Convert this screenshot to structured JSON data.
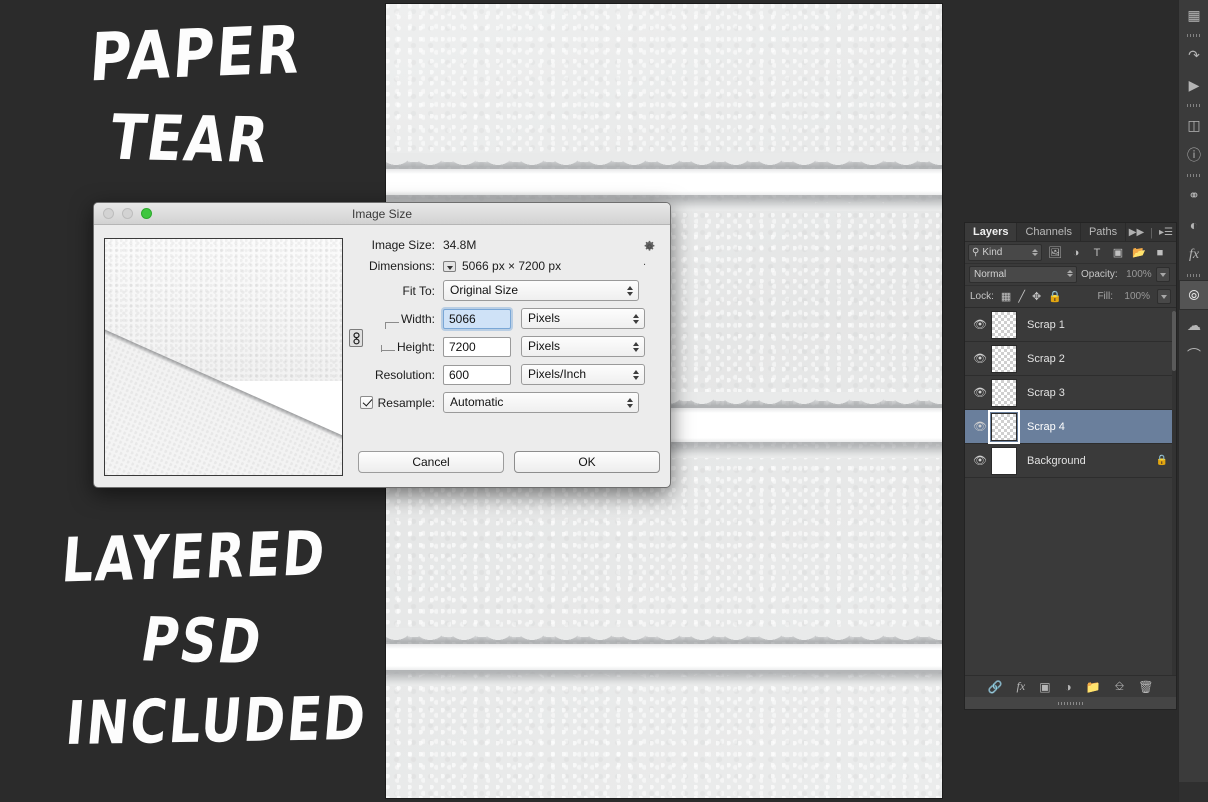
{
  "promo": {
    "line1": "PAPER",
    "line2": "TEAR",
    "line3": "LAYERED",
    "line4": "PSD",
    "line5": "INCLUDED"
  },
  "colors": {
    "app_background": "#2b2b2b",
    "panel_background": "#3a3a3a",
    "selection_blue": "#6a7f9c",
    "dialog_background": "#ececec",
    "focus_field_blue": "#cfe2f7",
    "traffic_light_green": "#3fc63f",
    "paper_gray": "#e9eaea",
    "tear_white": "#ffffff"
  },
  "dialog": {
    "title": "Image Size",
    "traffic_lights": [
      "close-disabled",
      "minimize-disabled",
      "zoom-green"
    ],
    "gear_icon": "gear-icon",
    "rows": {
      "image_size_label": "Image Size:",
      "image_size_value": "34.8M",
      "dimensions_label": "Dimensions:",
      "dimensions_value": "5066 px  ×  7200 px",
      "fit_to_label": "Fit To:",
      "fit_to_value": "Original Size",
      "width_label": "Width:",
      "width_value": "5066",
      "width_unit": "Pixels",
      "height_label": "Height:",
      "height_value": "7200",
      "height_unit": "Pixels",
      "resolution_label": "Resolution:",
      "resolution_value": "600",
      "resolution_unit": "Pixels/Inch",
      "resample_label": "Resample:",
      "resample_value": "Automatic",
      "resample_checked": true,
      "constrain_icon": "chain-link-icon"
    },
    "buttons": {
      "cancel": "Cancel",
      "ok": "OK"
    }
  },
  "layers_panel": {
    "tabs": [
      {
        "label": "Layers",
        "active": true
      },
      {
        "label": "Channels",
        "active": false
      },
      {
        "label": "Paths",
        "active": false
      }
    ],
    "collapse_icon": "double-chevron-right-icon",
    "menu_icon": "panel-menu-icon",
    "filter": {
      "search_icon": "search-icon",
      "kind_label": "Kind",
      "icons": [
        "pixel-layer-filter-icon",
        "adjustment-layer-filter-icon",
        "type-layer-filter-icon",
        "shape-layer-filter-icon",
        "smart-object-filter-icon",
        "filter-toggle-icon"
      ]
    },
    "blend": {
      "mode": "Normal",
      "opacity_label": "Opacity:",
      "opacity_value": "100%"
    },
    "lock": {
      "label": "Lock:",
      "icons": [
        "lock-transparent-pixels-icon",
        "lock-image-pixels-icon",
        "lock-position-icon",
        "lock-all-icon"
      ],
      "fill_label": "Fill:",
      "fill_value": "100%"
    },
    "layers": [
      {
        "name": "Scrap 1",
        "visible": true,
        "selected": false,
        "thumb": "checker",
        "locked": false
      },
      {
        "name": "Scrap 2",
        "visible": true,
        "selected": false,
        "thumb": "checker",
        "locked": false
      },
      {
        "name": "Scrap 3",
        "visible": true,
        "selected": false,
        "thumb": "checker",
        "locked": false
      },
      {
        "name": "Scrap 4",
        "visible": true,
        "selected": true,
        "thumb": "checker",
        "locked": false
      },
      {
        "name": "Background",
        "visible": true,
        "selected": false,
        "thumb": "white",
        "locked": true
      }
    ],
    "footer_icons": [
      "link-layers-icon",
      "layer-style-fx-icon",
      "add-layer-mask-icon",
      "new-adjustment-layer-icon",
      "new-group-icon",
      "new-layer-icon",
      "delete-layer-icon"
    ]
  },
  "icon_dock": {
    "items": [
      {
        "icon": "grid-icon",
        "active": false
      },
      {
        "icon": "history-icon",
        "active": false
      },
      {
        "icon": "actions-play-icon",
        "active": false
      },
      {
        "icon": "properties-icon",
        "active": false
      },
      {
        "icon": "info-icon",
        "active": false
      },
      {
        "icon": "creative-cloud-libraries-icon",
        "active": false
      },
      {
        "icon": "adjustments-icon",
        "active": false
      },
      {
        "icon": "styles-fx-icon",
        "active": false
      },
      {
        "icon": "layers-icon",
        "active": true
      },
      {
        "icon": "channels-icon",
        "active": false
      },
      {
        "icon": "paths-icon",
        "active": false
      }
    ]
  },
  "canvas": {
    "document_label": "paper-tear-document",
    "tear_count": 3
  }
}
